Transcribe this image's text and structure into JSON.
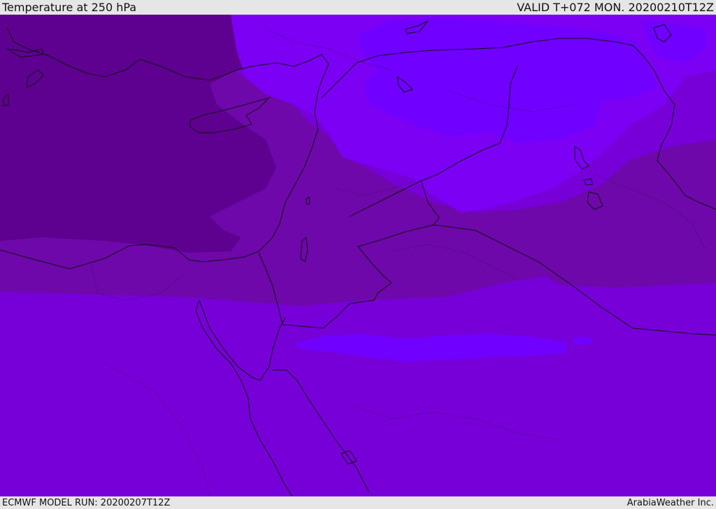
{
  "header": {
    "title": "Temperature at 250 hPa",
    "valid_time": "VALID T+072 MON. 20200210T12Z"
  },
  "footer": {
    "model_run": "ECMWF MODEL RUN: 20200207T12Z",
    "credit": "ArabiaWeather Inc."
  },
  "map": {
    "colors": {
      "darkest": "#5e0090",
      "dark": "#6e08aa",
      "medium": "#7700d8",
      "light": "#7c00f4",
      "lightest": "#7000ff",
      "border_line": "#111111"
    }
  }
}
